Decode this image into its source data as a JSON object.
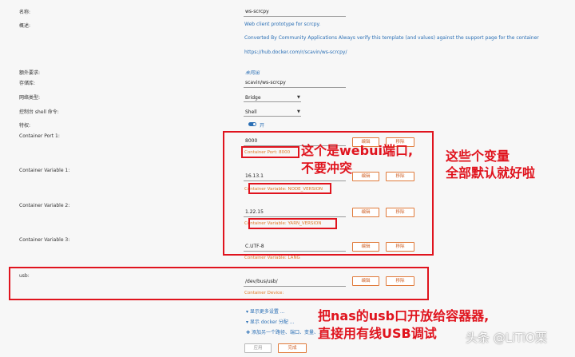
{
  "form": {
    "name": {
      "label": "名称:",
      "value": "ws-scrcpy"
    },
    "description": {
      "label": "概述:",
      "line1": "Web client prototype for scrcpy.",
      "line2": "Converted By Community Applications Always verify this template (and values) against the support page for the container",
      "line3": "https://hub.docker.com/r/scavin/ws-scrcpy/"
    },
    "extra": {
      "label": "额外要求:",
      "value": "未同出"
    },
    "repository": {
      "label": "存储库:",
      "value": "scavin/ws-scrcpy"
    },
    "network": {
      "label": "网络类型:",
      "value": "Bridge"
    },
    "shell": {
      "label": "控制台 shell 命令:",
      "value": "Shell"
    },
    "privileged": {
      "label": "特权:",
      "value": "开"
    },
    "port1": {
      "label": "Container Port 1:",
      "value": "8000",
      "desc": "Container Port: 8000"
    },
    "var1": {
      "label": "Container Variable 1:",
      "value": "16.13.1",
      "desc": "Container Variable: NODE_VERSION"
    },
    "var2": {
      "label": "Container Variable 2:",
      "value": "1.22.15",
      "desc": "Container Variable: YARN_VERSION"
    },
    "var3": {
      "label": "Container Variable 3:",
      "value": "C.UTF-8",
      "desc": "Container Variable: LANG"
    },
    "usb": {
      "label": "usb:",
      "value": "/dev/bus/usb/",
      "desc": "Container Device:"
    }
  },
  "buttons": {
    "edit": "编辑",
    "remove": "移除",
    "apply": "应用",
    "done": "完成"
  },
  "links": {
    "more_settings": "显示更多设置 ...",
    "docker_allocations": "显示 docker 分配 ...",
    "add_another": "添加另一个路径、端口、变量、..."
  },
  "annotations": {
    "webui_port_line1": "这个是webui端口,",
    "webui_port_line2": "不要冲突",
    "variables_line1": "这些个变量",
    "variables_line2": "全部默认就好啦",
    "usb_line1": "把nas的usb口开放给容器器,",
    "usb_line2": "直接用有线USB调试"
  },
  "watermark": "头条 @LiTiO栗",
  "colors": {
    "annotation": "#e0141e",
    "link": "#2a6fb5",
    "button": "#e07a3a"
  }
}
